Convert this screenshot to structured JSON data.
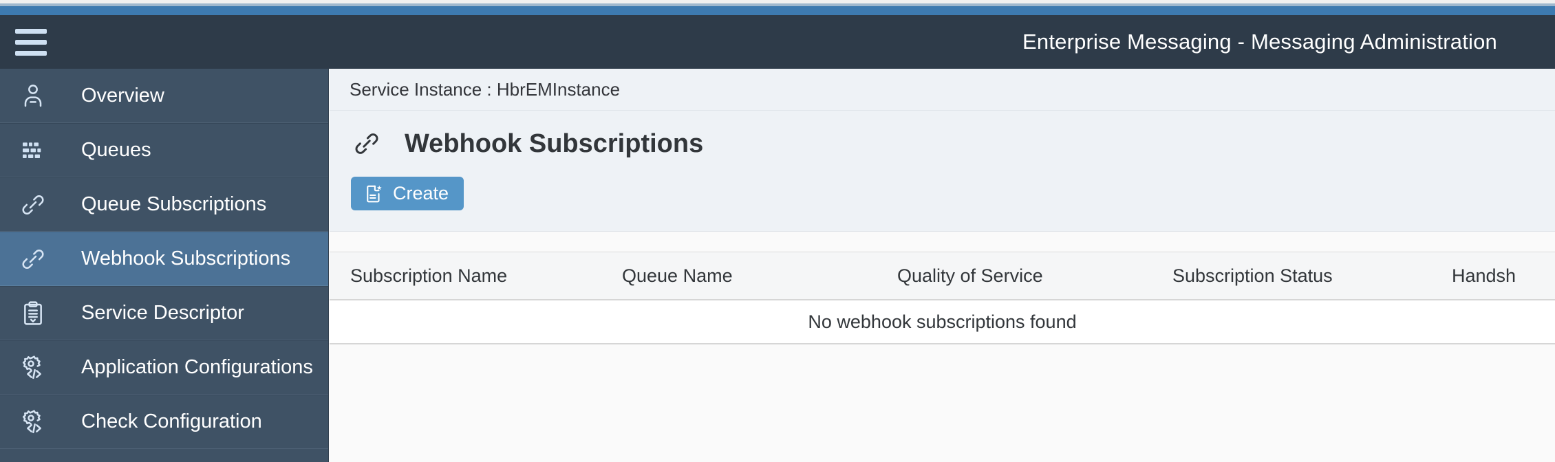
{
  "header": {
    "menu_icon": "hamburger-icon",
    "title": "Enterprise Messaging - Messaging Administration"
  },
  "colors": {
    "accent_bar": "#3d7ab0",
    "header_bg": "#2e3b49",
    "sidebar_bg": "#3f5265",
    "sidebar_selected": "#4c7296",
    "button_primary": "#5596c8",
    "content_bg": "#fafafa",
    "panel_bg": "#eef2f6"
  },
  "sidebar": {
    "items": [
      {
        "label": "Overview",
        "icon": "person-icon",
        "selected": false
      },
      {
        "label": "Queues",
        "icon": "grid-icon",
        "selected": false
      },
      {
        "label": "Queue Subscriptions",
        "icon": "link-icon",
        "selected": false
      },
      {
        "label": "Webhook Subscriptions",
        "icon": "link-icon",
        "selected": true
      },
      {
        "label": "Service Descriptor",
        "icon": "clipboard-icon",
        "selected": false
      },
      {
        "label": "Application Configurations",
        "icon": "gear-code-icon",
        "selected": false
      },
      {
        "label": "Check Configuration",
        "icon": "gear-code-icon",
        "selected": false
      }
    ]
  },
  "breadcrumb": {
    "text": "Service Instance : HbrEMInstance"
  },
  "page": {
    "icon": "link-icon",
    "title": "Webhook Subscriptions"
  },
  "toolbar": {
    "create_label": "Create",
    "create_icon": "new-document-icon"
  },
  "table": {
    "columns": [
      "Subscription Name",
      "Queue Name",
      "Quality of Service",
      "Subscription Status",
      "Handsh"
    ],
    "rows": [],
    "empty_message": "No webhook subscriptions found"
  }
}
